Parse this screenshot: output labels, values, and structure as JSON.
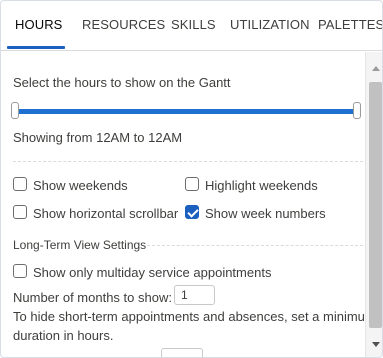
{
  "tabs": [
    {
      "label": "HOURS",
      "active": true
    },
    {
      "label": "RESOURCES",
      "active": false
    },
    {
      "label": "SKILLS",
      "active": false
    },
    {
      "label": "UTILIZATION",
      "active": false
    },
    {
      "label": "PALETTES",
      "active": false
    }
  ],
  "hours": {
    "slider_label": "Select the hours to show on the Gantt",
    "range_text": "Showing from 12AM to 12AM",
    "slider_color": "#1f6fd1"
  },
  "options": {
    "show_weekends": {
      "label": "Show weekends",
      "checked": false
    },
    "highlight_weekends": {
      "label": "Highlight weekends",
      "checked": false
    },
    "show_horizontal_scrollbar": {
      "label": "Show horizontal scrollbar",
      "checked": false
    },
    "show_week_numbers": {
      "label": "Show week numbers",
      "checked": true
    }
  },
  "long_term": {
    "section_title": "Long-Term View Settings",
    "multiday_only": {
      "label": "Show only multiday service appointments",
      "checked": false
    },
    "months_label": "Number of months to show:",
    "months_value": "1",
    "hint": "To hide short-term appointments and absences, set a minimum duration in hours.",
    "hint_line1": "To hide short-term appointments and absences, set a minimum",
    "hint_line2": "duration in hours."
  },
  "colors": {
    "accent": "#1b5fbf"
  }
}
